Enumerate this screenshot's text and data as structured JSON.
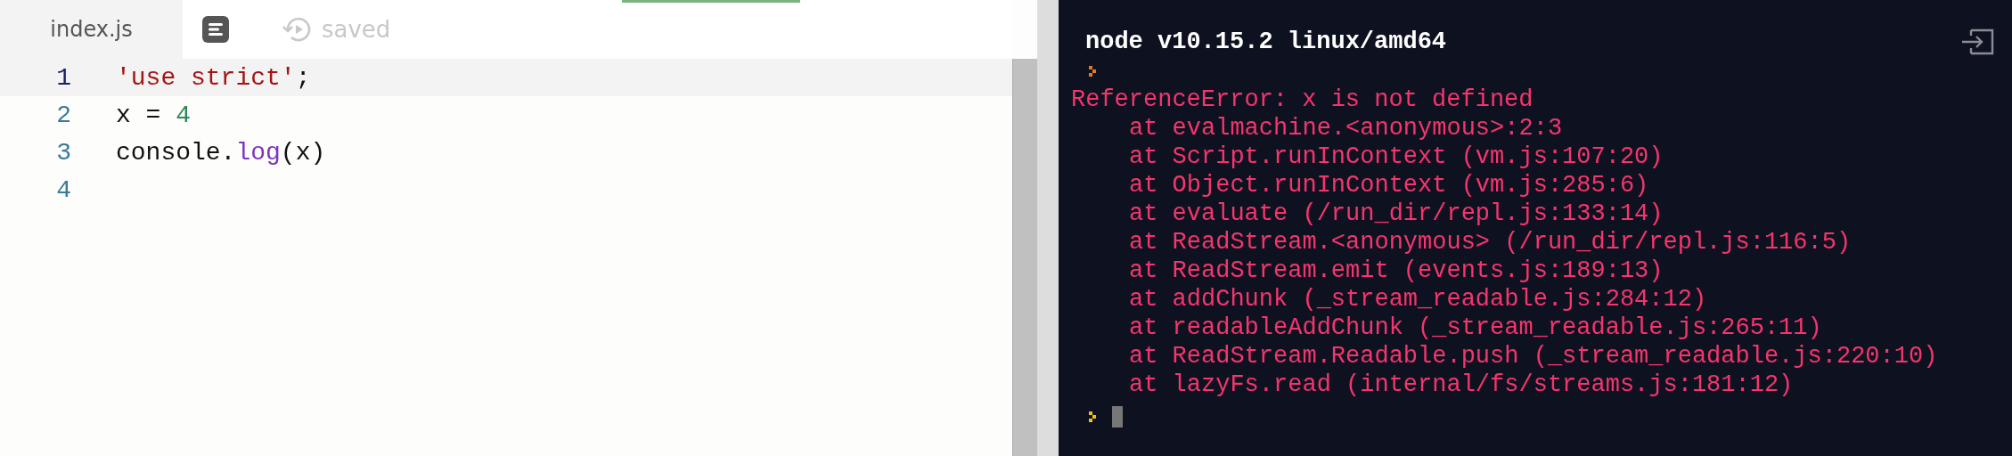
{
  "editor": {
    "tab": {
      "label": "index.js",
      "selected": true
    },
    "status": "saved",
    "lines": [
      {
        "number": "1",
        "active": true,
        "tokens": [
          {
            "kind": "string",
            "text": "'use strict'"
          },
          {
            "kind": "plain",
            "text": ";"
          }
        ]
      },
      {
        "number": "2",
        "active": false,
        "tokens": [
          {
            "kind": "plain",
            "text": "x = "
          },
          {
            "kind": "number",
            "text": "4"
          }
        ]
      },
      {
        "number": "3",
        "active": false,
        "tokens": [
          {
            "kind": "plain",
            "text": "console."
          },
          {
            "kind": "method",
            "text": "log"
          },
          {
            "kind": "plain",
            "text": "(x)"
          }
        ]
      },
      {
        "number": "4",
        "active": false
      }
    ]
  },
  "console": {
    "header": "node v10.15.2 linux/amd64",
    "output": [
      {
        "kind": "prompt"
      },
      {
        "kind": "message",
        "text": "ReferenceError: x is not defined"
      },
      {
        "kind": "frame",
        "text": "at evalmachine.<anonymous>:2:3"
      },
      {
        "kind": "frame",
        "text": "at Script.runInContext (vm.js:107:20)"
      },
      {
        "kind": "frame",
        "text": "at Object.runInContext (vm.js:285:6)"
      },
      {
        "kind": "frame",
        "text": "at evaluate (/run_dir/repl.js:133:14)"
      },
      {
        "kind": "frame",
        "text": "at ReadStream.<anonymous> (/run_dir/repl.js:116:5)"
      },
      {
        "kind": "frame",
        "text": "at ReadStream.emit (events.js:189:13)"
      },
      {
        "kind": "frame",
        "text": "at addChunk (_stream_readable.js:284:12)"
      },
      {
        "kind": "frame",
        "text": "at readableAddChunk (_stream_readable.js:265:11)"
      },
      {
        "kind": "frame",
        "text": "at ReadStream.Readable.push (_stream_readable.js:220:10)"
      },
      {
        "kind": "frame",
        "text": "at lazyFs.read (internal/fs/streams.js:181:12)"
      },
      {
        "kind": "input"
      }
    ]
  }
}
